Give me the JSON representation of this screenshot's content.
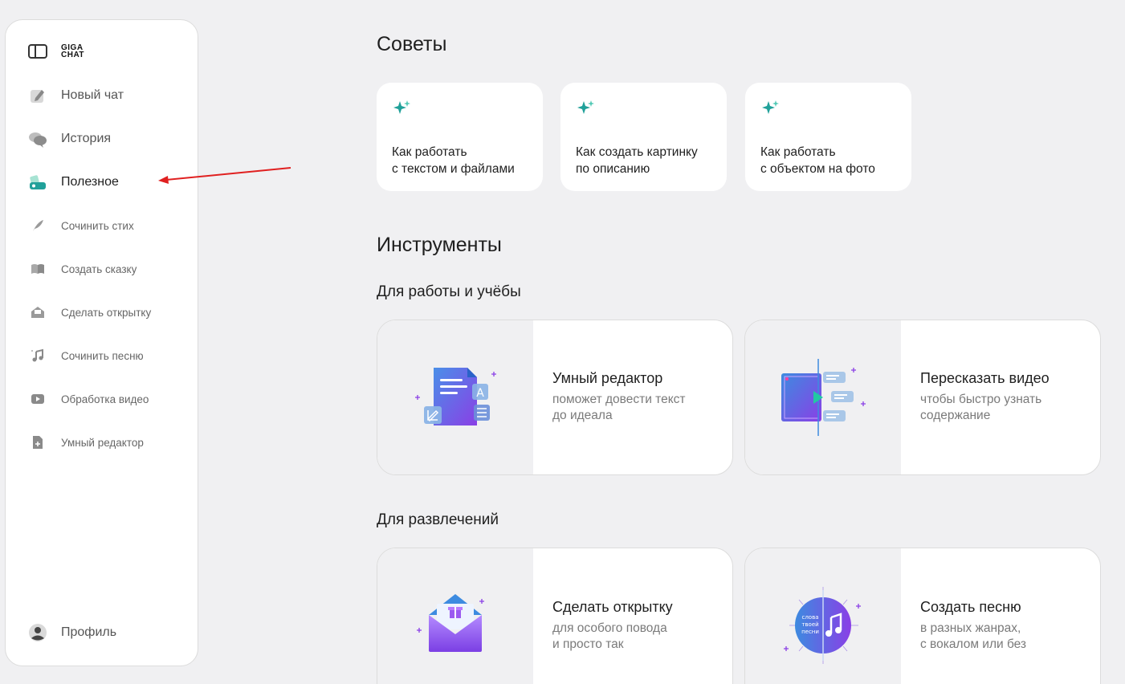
{
  "sidebar": {
    "logo": "GIGA CHAT",
    "items": [
      {
        "label": "Новый чат"
      },
      {
        "label": "История"
      },
      {
        "label": "Полезное"
      },
      {
        "label": "Сочинить стих"
      },
      {
        "label": "Создать сказку"
      },
      {
        "label": "Сделать открытку"
      },
      {
        "label": "Сочинить песню"
      },
      {
        "label": "Обработка видео"
      },
      {
        "label": "Умный редактор"
      }
    ],
    "profile": "Профиль",
    "active_item": "Полезное"
  },
  "main": {
    "tips_title": "Советы",
    "tips": [
      {
        "line1": "Как работать",
        "line2": "с текстом и файлами"
      },
      {
        "line1": "Как создать картинку",
        "line2": "по описанию"
      },
      {
        "line1": "Как работать",
        "line2": "с объектом на фото"
      }
    ],
    "tools_title": "Инструменты",
    "work_section": "Для работы и учёбы",
    "fun_section": "Для развлечений",
    "tools": [
      {
        "title": "Умный редактор",
        "desc1": "поможет довести текст",
        "desc2": "до идеала",
        "icon": "document-edit-icon"
      },
      {
        "title": "Пересказать видео",
        "desc1": "чтобы быстро узнать",
        "desc2": "содержание",
        "icon": "video-summary-icon"
      },
      {
        "title": "Сделать открытку",
        "desc1": "для особого повода",
        "desc2": "и просто так",
        "icon": "gift-envelope-icon"
      },
      {
        "title": "Создать песню",
        "desc1": "в разных жанрах,",
        "desc2": "с вокалом или без",
        "icon": "music-disc-icon"
      }
    ],
    "song_disc_text": [
      "слова",
      "твоей",
      "песни"
    ]
  },
  "colors": {
    "accent_green": "#21a19a",
    "purple": "#7b3fe4",
    "blue": "#3d8be0",
    "arrow": "#e02020"
  }
}
